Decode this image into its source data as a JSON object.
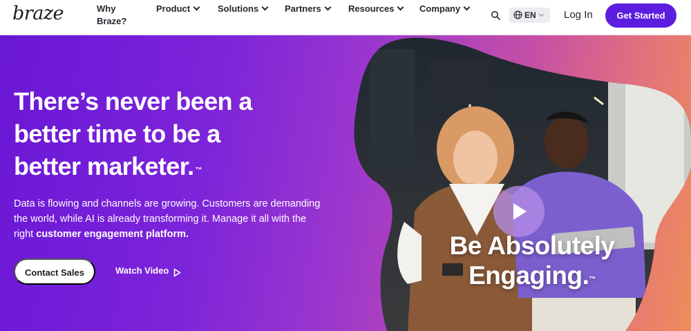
{
  "brand": {
    "logo_text": "braze",
    "accent": "#5c1de0"
  },
  "nav": {
    "why_line1": "Why",
    "why_line2": "Braze?",
    "items": [
      {
        "label": "Product"
      },
      {
        "label": "Solutions"
      },
      {
        "label": "Partners"
      },
      {
        "label": "Resources"
      },
      {
        "label": "Company"
      }
    ],
    "language": "EN",
    "login": "Log In",
    "cta": "Get Started"
  },
  "hero": {
    "headline_line1": "There’s never been a",
    "headline_line2": "better time to be a",
    "headline_line3": "better marketer.",
    "trademark": "™",
    "subtext_plain": "Data is flowing and channels are growing. Customers are demanding the world, while AI is already transforming it. Manage it all with the right ",
    "subtext_bold": "customer engagement platform.",
    "primary_button": "Contact Sales",
    "secondary_link": "Watch Video",
    "video_overlay_line1": "Be Absolutely",
    "video_overlay_line2": "Engaging."
  }
}
